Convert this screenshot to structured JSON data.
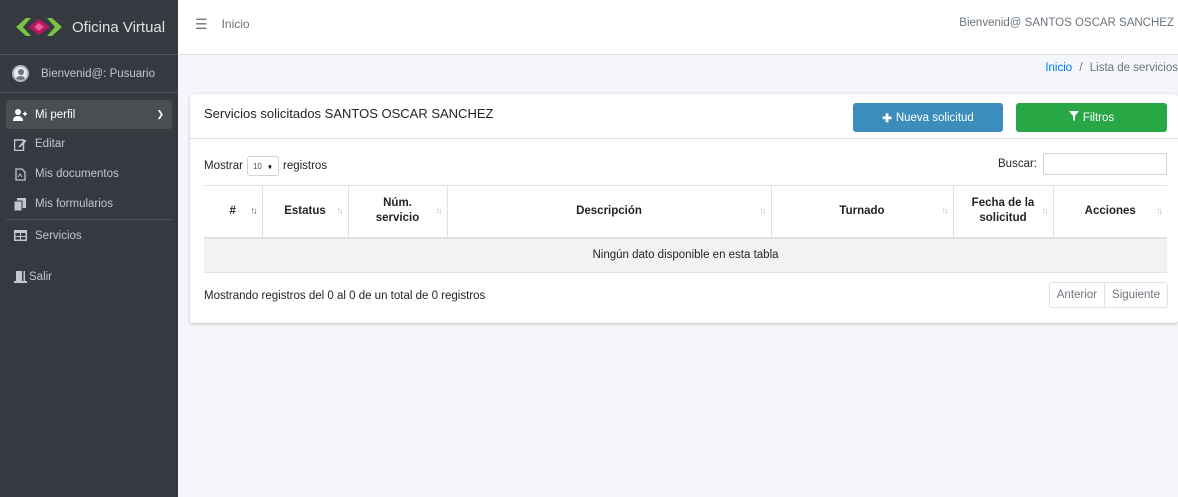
{
  "sidebar": {
    "brand": "Oficina Virtual",
    "user": "Bienvenid@: Pusuario",
    "items": [
      {
        "label": "Mi perfil",
        "icon": "user-plus-icon"
      },
      {
        "label": "Editar",
        "icon": "edit-icon"
      },
      {
        "label": "Mis documentos",
        "icon": "document-icon"
      },
      {
        "label": "Mis formularios",
        "icon": "copy-icon"
      },
      {
        "label": "Servicios",
        "icon": "table-icon"
      },
      {
        "label": "Salir",
        "icon": "exit-icon"
      }
    ]
  },
  "navbar": {
    "home": "Inicio",
    "welcome": "Bienvenid@ SANTOS OSCAR SANCHEZ"
  },
  "breadcrumb": {
    "home": "Inicio",
    "separator": "/",
    "current": "Lista de servicios"
  },
  "card": {
    "title": "Servicios solicitados SANTOS OSCAR SANCHEZ",
    "new_button": "Nueva solicitud",
    "filter_button": "Filtros"
  },
  "table": {
    "show_label": "Mostrar",
    "page_size": "10",
    "records_label": "registros",
    "search_label": "Buscar:",
    "search_value": "",
    "columns": [
      "#",
      "Estatus",
      "Núm. servicio",
      "Descripción",
      "Turnado",
      "Fecha de la solicitud",
      "Acciones"
    ],
    "empty_text": "Ningún dato disponible en esta tabla",
    "info": "Mostrando registros del 0 al 0 de un total de 0 registros",
    "prev": "Anterior",
    "next": "Siguiente"
  },
  "colors": {
    "sidebar": "#343a40",
    "primary_button": "#3c8dbc",
    "success_button": "#28a745",
    "link": "#007bff"
  }
}
